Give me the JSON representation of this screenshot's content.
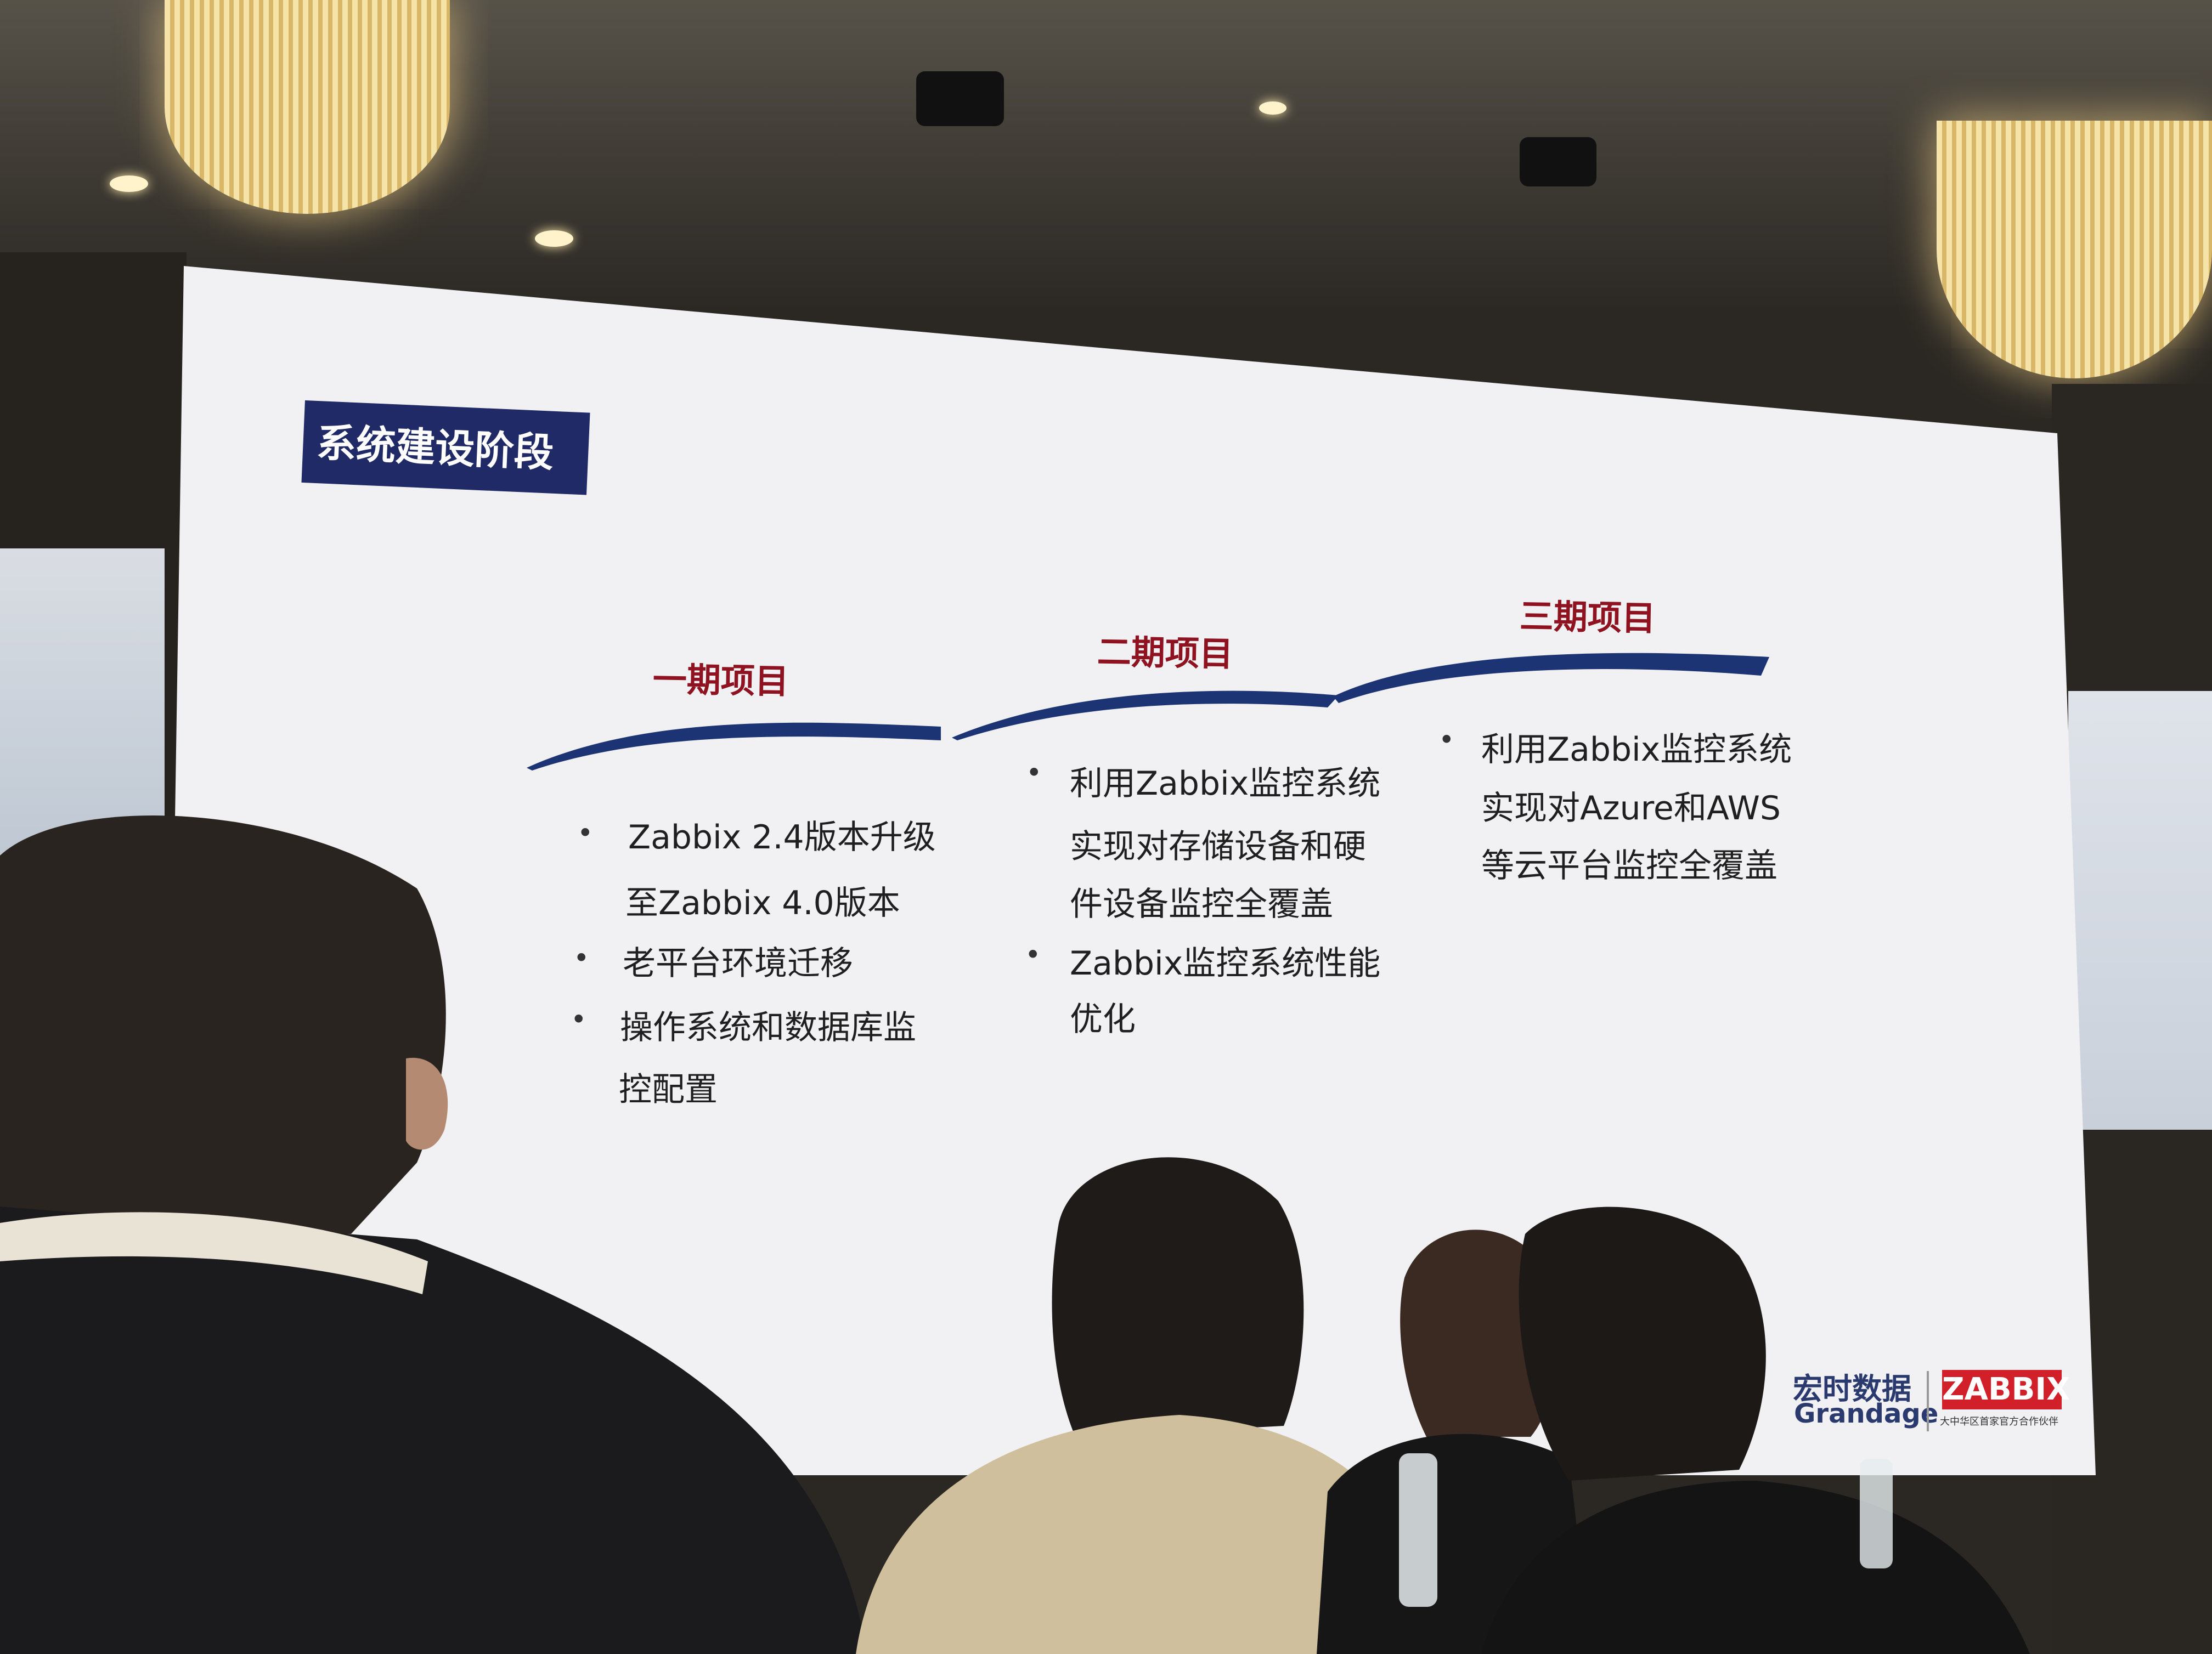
{
  "slide": {
    "title": "系统建设阶段",
    "phases": [
      {
        "heading": "一期项目",
        "items": [
          [
            "Zabbix 2.4版本升级",
            "至Zabbix 4.0版本"
          ],
          [
            "老平台环境迁移"
          ],
          [
            "操作系统和数据库监",
            "控配置"
          ]
        ]
      },
      {
        "heading": "二期项目",
        "items": [
          [
            "利用Zabbix监控系统",
            "实现对存储设备和硬",
            "件设备监控全覆盖"
          ],
          [
            "Zabbix监控系统性能",
            "优化"
          ]
        ]
      },
      {
        "heading": "三期项目",
        "items": [
          [
            "利用Zabbix监控系统",
            "实现对Azure和AWS",
            "等云平台监控全覆盖"
          ]
        ]
      }
    ],
    "bullet_char": "•",
    "logo": {
      "company_cn": "宏时数据",
      "company_en": "Grandage",
      "brand": "ZABBIX",
      "brand_sub": "大中华区首家官方合作伙伴"
    }
  },
  "colors": {
    "title_bg": "#1f2a66",
    "phase_heading": "#8e1220",
    "curve": "#1c3474",
    "brand_red": "#d1202a"
  }
}
